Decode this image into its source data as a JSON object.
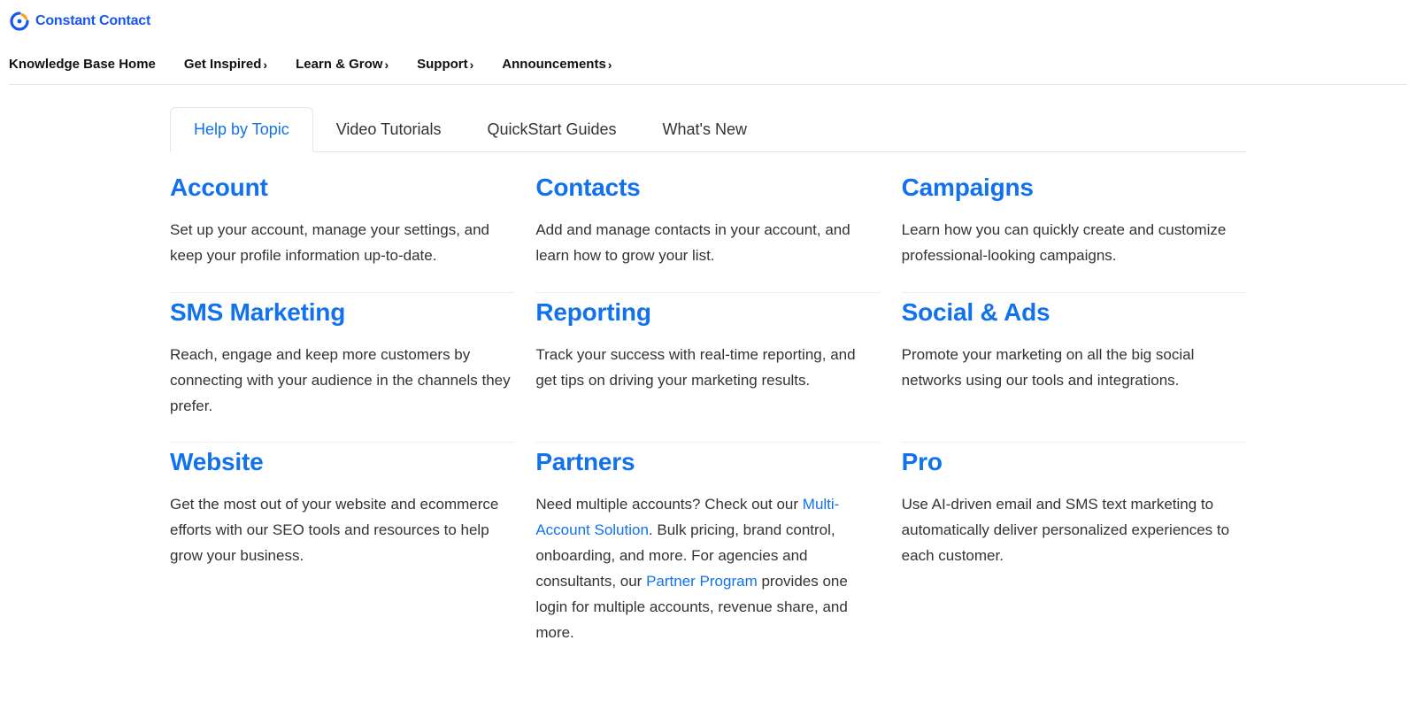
{
  "brand": {
    "name": "Constant Contact"
  },
  "nav": {
    "items": [
      {
        "label": "Knowledge Base Home",
        "has_menu": false
      },
      {
        "label": "Get Inspired",
        "has_menu": true
      },
      {
        "label": "Learn & Grow",
        "has_menu": true
      },
      {
        "label": "Support",
        "has_menu": true
      },
      {
        "label": "Announcements",
        "has_menu": true
      }
    ]
  },
  "tabs": [
    {
      "label": "Help by Topic",
      "active": true
    },
    {
      "label": "Video Tutorials",
      "active": false
    },
    {
      "label": "QuickStart Guides",
      "active": false
    },
    {
      "label": "What's New",
      "active": false
    }
  ],
  "topics": [
    {
      "title": "Account",
      "desc": "Set up your account, manage your settings, and keep your profile information up-to-date."
    },
    {
      "title": "Contacts",
      "desc": "Add and manage contacts in your account, and learn how to grow your list."
    },
    {
      "title": "Campaigns",
      "desc": "Learn how you can quickly create and customize professional-looking campaigns."
    },
    {
      "title": "SMS Marketing",
      "desc": "Reach, engage and keep more customers by connecting with your audience in the channels they prefer."
    },
    {
      "title": "Reporting",
      "desc": "Track your success with real-time reporting, and get tips on driving your marketing results."
    },
    {
      "title": "Social & Ads",
      "desc": "Promote your marketing on all the big social networks using our tools and integrations."
    },
    {
      "title": "Website",
      "desc": "Get the most out of your website and ecommerce efforts with our SEO tools and resources to help grow your business."
    },
    {
      "title": "Partners",
      "desc_parts": {
        "pre": "Need multiple accounts? Check out our ",
        "link1": "Multi-Account Solution",
        "mid": ". Bulk pricing, brand control, onboarding, and more. For agencies and consultants, our ",
        "link2": "Partner Program",
        "post": " provides one login for multiple accounts, revenue share, and more."
      }
    },
    {
      "title": "Pro",
      "desc": "Use AI-driven email and SMS text marketing to automatically deliver personalized experiences to each customer."
    }
  ]
}
